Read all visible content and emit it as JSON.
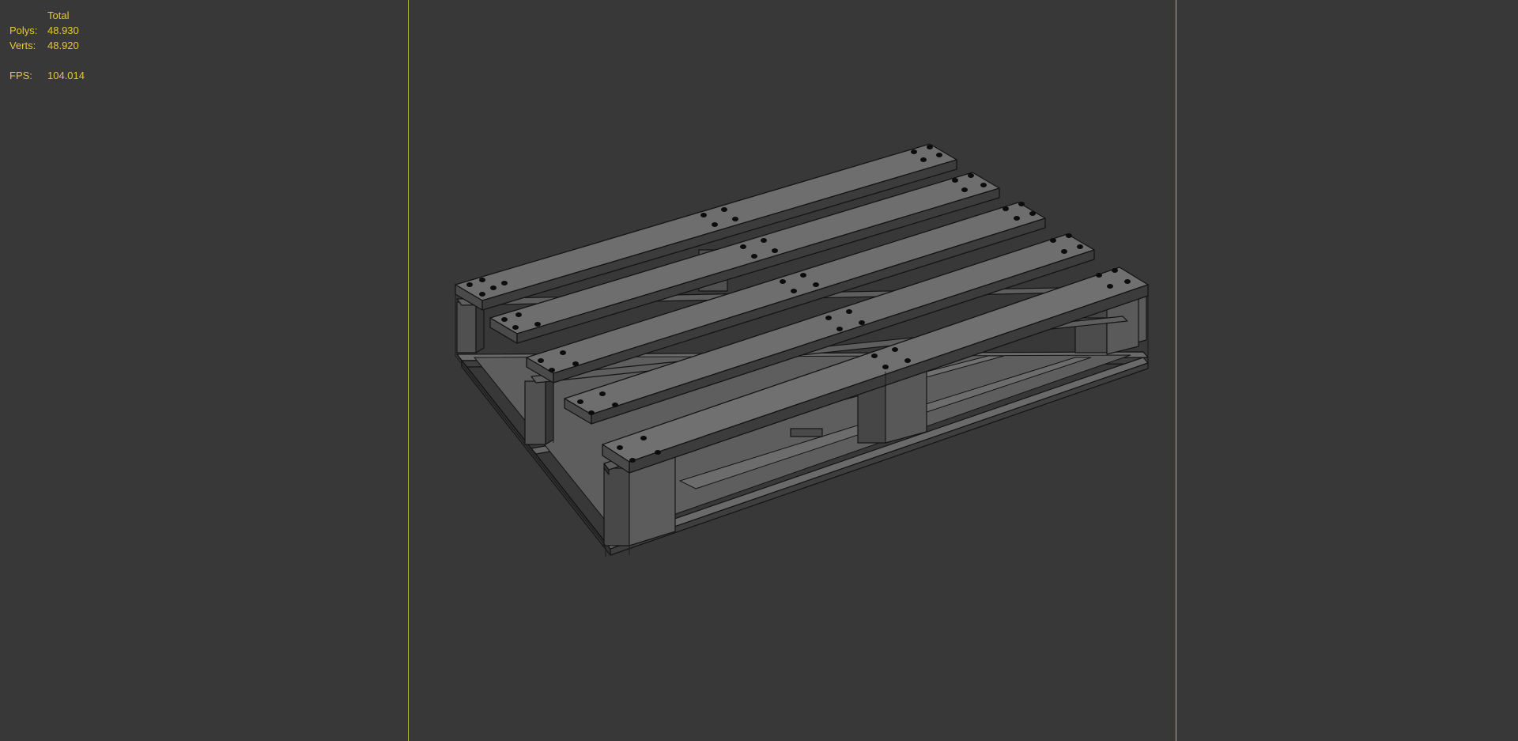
{
  "stats": {
    "header": "Total",
    "polys_label": "Polys:",
    "polys_value": "48.930",
    "verts_label": "Verts:",
    "verts_value": "48.920",
    "fps_label": "FPS:",
    "fps_value": "104.014"
  },
  "colors": {
    "viewport_background": "#383838",
    "stats_text": "#e6c832",
    "safe_frame": "#b6b62a",
    "model_top": "#6e6e6e",
    "model_side": "#4a4a4a",
    "model_edge": "#141414"
  },
  "scene": {
    "object": "wooden-pallet-model",
    "deck_boards": 5,
    "support_blocks": 9,
    "shading": "wireframe-on-shaded"
  }
}
